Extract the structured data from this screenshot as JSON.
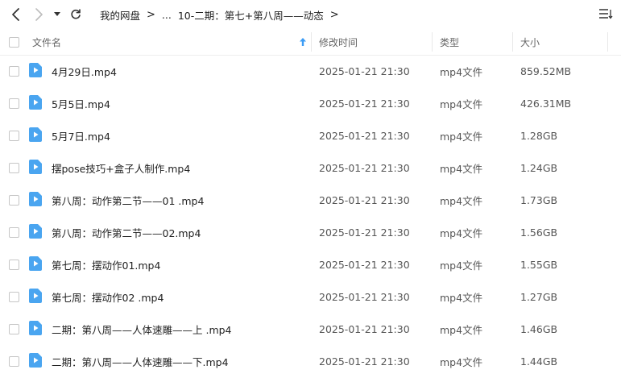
{
  "nav": {
    "back_icon": "chevron-left-icon",
    "forward_icon": "chevron-right-icon",
    "history_icon": "caret-down-icon",
    "refresh_icon": "refresh-icon",
    "view_icon": "list-view-icon"
  },
  "breadcrumb": {
    "root": "我的网盘",
    "ellipsis": "...",
    "parent": "10-二期：第七+第八周——动态",
    "separator": ">"
  },
  "header": {
    "name": "文件名",
    "modified": "修改时间",
    "type": "类型",
    "size": "大小",
    "sort_icon": "sort-up-arrow-icon"
  },
  "files": [
    {
      "name": "4月29日.mp4",
      "modified": "2025-01-21 21:30",
      "type": "mp4文件",
      "size": "859.52MB"
    },
    {
      "name": "5月5日.mp4",
      "modified": "2025-01-21 21:30",
      "type": "mp4文件",
      "size": "426.31MB"
    },
    {
      "name": "5月7日.mp4",
      "modified": "2025-01-21 21:30",
      "type": "mp4文件",
      "size": "1.28GB"
    },
    {
      "name": "摆pose技巧+盒子人制作.mp4",
      "modified": "2025-01-21 21:30",
      "type": "mp4文件",
      "size": "1.24GB"
    },
    {
      "name": "第八周：动作第二节——01 .mp4",
      "modified": "2025-01-21 21:30",
      "type": "mp4文件",
      "size": "1.73GB"
    },
    {
      "name": "第八周：动作第二节——02.mp4",
      "modified": "2025-01-21 21:30",
      "type": "mp4文件",
      "size": "1.56GB"
    },
    {
      "name": "第七周：摆动作01.mp4",
      "modified": "2025-01-21 21:30",
      "type": "mp4文件",
      "size": "1.55GB"
    },
    {
      "name": "第七周：摆动作02 .mp4",
      "modified": "2025-01-21 21:30",
      "type": "mp4文件",
      "size": "1.27GB"
    },
    {
      "name": "二期：第八周——人体速雕——上 .mp4",
      "modified": "2025-01-21 21:30",
      "type": "mp4文件",
      "size": "1.46GB"
    },
    {
      "name": "二期：第八周——人体速雕——下.mp4",
      "modified": "2025-01-21 21:30",
      "type": "mp4文件",
      "size": "1.44GB"
    }
  ],
  "colors": {
    "accent": "#3b9cf5",
    "file_icon": "#4aa5f0"
  }
}
